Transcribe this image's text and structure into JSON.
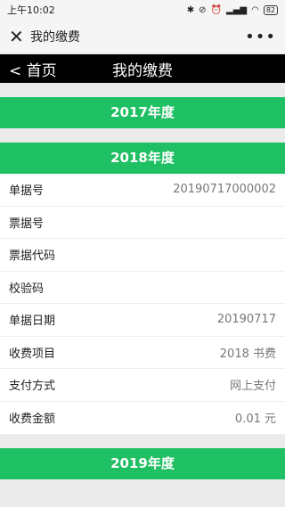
{
  "status": {
    "time": "上午10:02",
    "battery": "82"
  },
  "wx_bar": {
    "title": "我的缴费"
  },
  "nav": {
    "back_label": "< 首页",
    "title": "我的缴费"
  },
  "years": [
    "2017年度",
    "2018年度",
    "2019年度"
  ],
  "record_2018": [
    {
      "label": "单据号",
      "value": "20190717000002"
    },
    {
      "label": "票据号",
      "value": ""
    },
    {
      "label": "票据代码",
      "value": ""
    },
    {
      "label": "校验码",
      "value": ""
    },
    {
      "label": "单据日期",
      "value": "20190717"
    },
    {
      "label": "收费项目",
      "value": "2018 书费"
    },
    {
      "label": "支付方式",
      "value": "网上支付"
    },
    {
      "label": "收费金额",
      "value": "0.01 元"
    }
  ]
}
